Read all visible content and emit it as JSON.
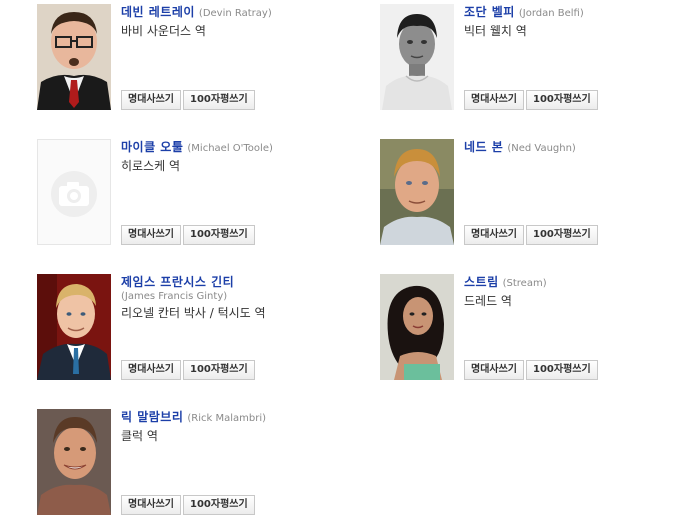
{
  "buttons": {
    "quote": "명대사쓰기",
    "review": "100자평쓰기"
  },
  "cast": [
    {
      "name_ko": "데빈 레트레이",
      "name_en": "(Devin Ratray)",
      "role": "바비 사운더스 역",
      "photo": "devin-ratray-photo"
    },
    {
      "name_ko": "조단 벨피",
      "name_en": "(Jordan Belfi)",
      "role": "빅터 웰치 역",
      "photo": "jordan-belfi-photo"
    },
    {
      "name_ko": "마이클 오툴",
      "name_en": "(Michael O'Toole)",
      "role": "히로스케 역",
      "photo": "no-photo-camera-icon"
    },
    {
      "name_ko": "네드 본",
      "name_en": "(Ned Vaughn)",
      "role": "",
      "photo": "ned-vaughn-photo"
    },
    {
      "name_ko": "제임스 프란시스 긴티",
      "name_en": "(James Francis Ginty)",
      "role": "리오넬 칸터 박사 / 턱시도 역",
      "photo": "james-ginty-photo"
    },
    {
      "name_ko": "스트림",
      "name_en": "(Stream)",
      "role": "드레드 역",
      "photo": "stream-photo"
    },
    {
      "name_ko": "릭 말람브리",
      "name_en": "(Rick Malambri)",
      "role": "클럭 역",
      "photo": "rick-malambri-photo"
    }
  ]
}
